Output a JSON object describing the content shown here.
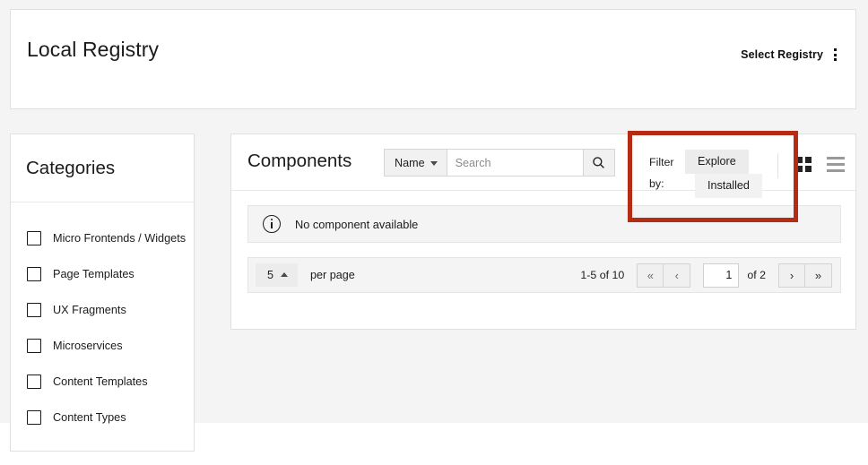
{
  "header": {
    "title": "Local Registry",
    "registry_select_label": "Select Registry",
    "kebab_icon": "vertical-dots-icon"
  },
  "sidebar": {
    "title": "Categories",
    "items": [
      {
        "label": "Micro Frontends / Widgets",
        "checked": false
      },
      {
        "label": "Page Templates",
        "checked": false
      },
      {
        "label": "UX Fragments",
        "checked": false
      },
      {
        "label": "Microservices",
        "checked": false
      },
      {
        "label": "Content Templates",
        "checked": false
      },
      {
        "label": "Content Types",
        "checked": false
      }
    ]
  },
  "components": {
    "title": "Components",
    "sort": {
      "selected": "Name",
      "caret_icon": "chevron-down-icon"
    },
    "search": {
      "value": "",
      "placeholder": "Search",
      "button_icon": "search-icon"
    },
    "filter": {
      "label_line1": "Filter",
      "label_line2": "by:",
      "options": [
        {
          "label": "Explore",
          "active": true
        },
        {
          "label": "Installed",
          "active": false
        }
      ]
    },
    "view": {
      "grid_icon": "grid-view-icon",
      "list_icon": "list-view-icon",
      "selected": "grid"
    },
    "alert": {
      "icon": "info-circle-icon",
      "message": "No component available"
    },
    "pagination": {
      "per_page_value": "5",
      "per_page_caret_icon": "chevron-up-icon",
      "per_page_label": "per page",
      "range": "1-5 of 10",
      "first_label": "«",
      "prev_label": "‹",
      "next_label": "›",
      "last_label": "»",
      "current_page": "1",
      "of_label": "of 2"
    }
  },
  "annotation": {
    "highlight_color": "#b52b14"
  }
}
